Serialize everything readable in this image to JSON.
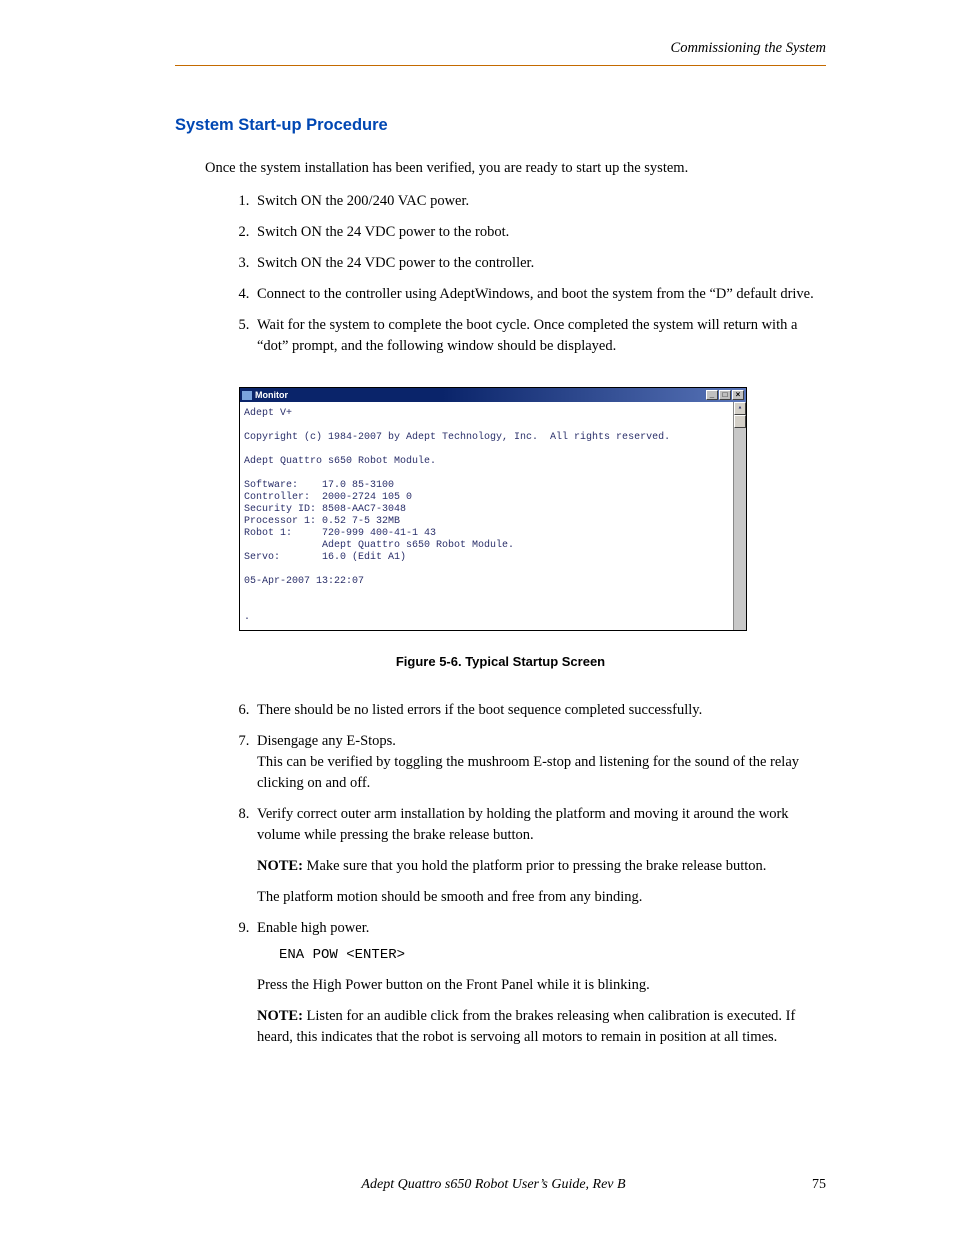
{
  "header": {
    "running_head": "Commissioning the System"
  },
  "section": {
    "heading": "System Start-up Procedure",
    "intro": "Once the system installation has been verified, you are ready to start up the system."
  },
  "steps1": [
    "Switch ON the 200/240 VAC power.",
    "Switch ON the 24 VDC power to the robot.",
    "Switch ON the 24 VDC power to the controller.",
    "Connect to the controller using AdeptWindows, and boot the system from the “D” default drive.",
    "Wait for the system to complete the boot cycle. Once completed the system will return with a “dot” prompt, and the following window should be displayed."
  ],
  "monitor": {
    "title": "Monitor",
    "lines": [
      "Adept V+",
      "",
      "Copyright (c) 1984-2007 by Adept Technology, Inc.  All rights reserved.",
      "",
      "Adept Quattro s650 Robot Module.",
      "",
      "Software:    17.0 85-3100",
      "Controller:  2000-2724 105 0",
      "Security ID: 8508-AAC7-3048",
      "Processor 1: 0.52 7-5 32MB",
      "Robot 1:     720-999 400-41-1 43",
      "             Adept Quattro s650 Robot Module.",
      "Servo:       16.0 (Edit A1)",
      "",
      "05-Apr-2007 13:22:07",
      "",
      "",
      "."
    ]
  },
  "figure_caption": "Figure 5-6. Typical Startup Screen",
  "steps2": {
    "6": "There should be no listed errors if the boot sequence completed successfully.",
    "7a": "Disengage any E-Stops.",
    "7b": "This can be verified by toggling the mushroom E-stop and listening for the sound of the relay clicking on and off.",
    "8a": "Verify correct outer arm installation by holding the platform and moving it around the work volume while pressing the brake release button.",
    "8note_label": "NOTE:",
    "8note": " Make sure that you hold the platform prior to pressing the brake release button.",
    "8b": "The platform motion should be smooth and free from any binding.",
    "9a": "Enable high power.",
    "9code": "ENA POW <ENTER>",
    "9b": "Press the High Power button on the Front Panel while it is blinking.",
    "9note_label": "NOTE:",
    "9note": " Listen for an audible click from the brakes releasing when calibration is executed. If heard, this indicates that the robot is servoing all motors to remain in position at all times."
  },
  "footer": {
    "book": "Adept Quattro s650 Robot User’s Guide, Rev B",
    "page": "75"
  }
}
